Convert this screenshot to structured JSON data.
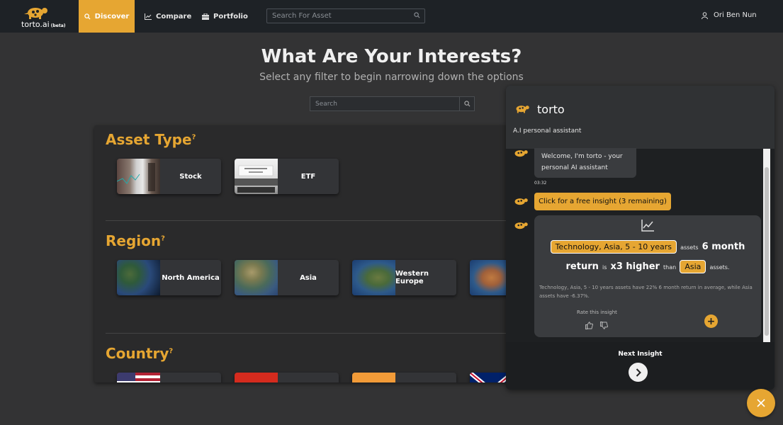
{
  "nav": {
    "brand": "torto.ai",
    "brand_tag": "(beta)",
    "tabs": [
      {
        "label": "Discover",
        "icon": "search-icon",
        "active": true
      },
      {
        "label": "Compare",
        "icon": "chart-line-icon",
        "active": false
      },
      {
        "label": "Portfolio",
        "icon": "briefcase-icon",
        "active": false
      }
    ],
    "search_placeholder": "Search For Asset",
    "user_name": "Ori Ben Nun"
  },
  "main": {
    "title": "What Are Your Interests?",
    "subtitle": "Select any filter to begin narrowing down the options",
    "search_placeholder": "Search"
  },
  "filters": {
    "asset_type": {
      "title": "Asset Type",
      "help": "?",
      "cards": [
        {
          "label": "Stock"
        },
        {
          "label": "ETF"
        }
      ]
    },
    "region": {
      "title": "Region",
      "help": "?",
      "cards": [
        {
          "label": "North America"
        },
        {
          "label": "Asia"
        },
        {
          "label": "Western Europe"
        },
        {
          "label": ""
        }
      ]
    },
    "country": {
      "title": "Country",
      "help": "?"
    }
  },
  "chat": {
    "name": "torto",
    "subtitle": "A.I personal assistant",
    "welcome": "Welcome, I'm torto - your personal AI assistant",
    "timestamp": "03:32",
    "insight_button": "Click for a free insight (3 remaining)",
    "insight": {
      "chip1": "Technology,  Asia,  5  -  10  years",
      "assets1": "assets",
      "metric": "6 month",
      "metric2": "return",
      "is": "is",
      "multiplier": "x3 higher",
      "than": "than",
      "chip2": "Asia",
      "assets2": "assets.",
      "description": "Technology, Asia, 5 - 10 years assets have 22% 6 month return in average, while Asia assets have -6.37%.",
      "rate_label": "Rate this insight"
    },
    "next_label": "Next Insight"
  },
  "colors": {
    "accent": "#e6a632",
    "nav_bg": "#1e2226",
    "page_bg": "#333334"
  }
}
